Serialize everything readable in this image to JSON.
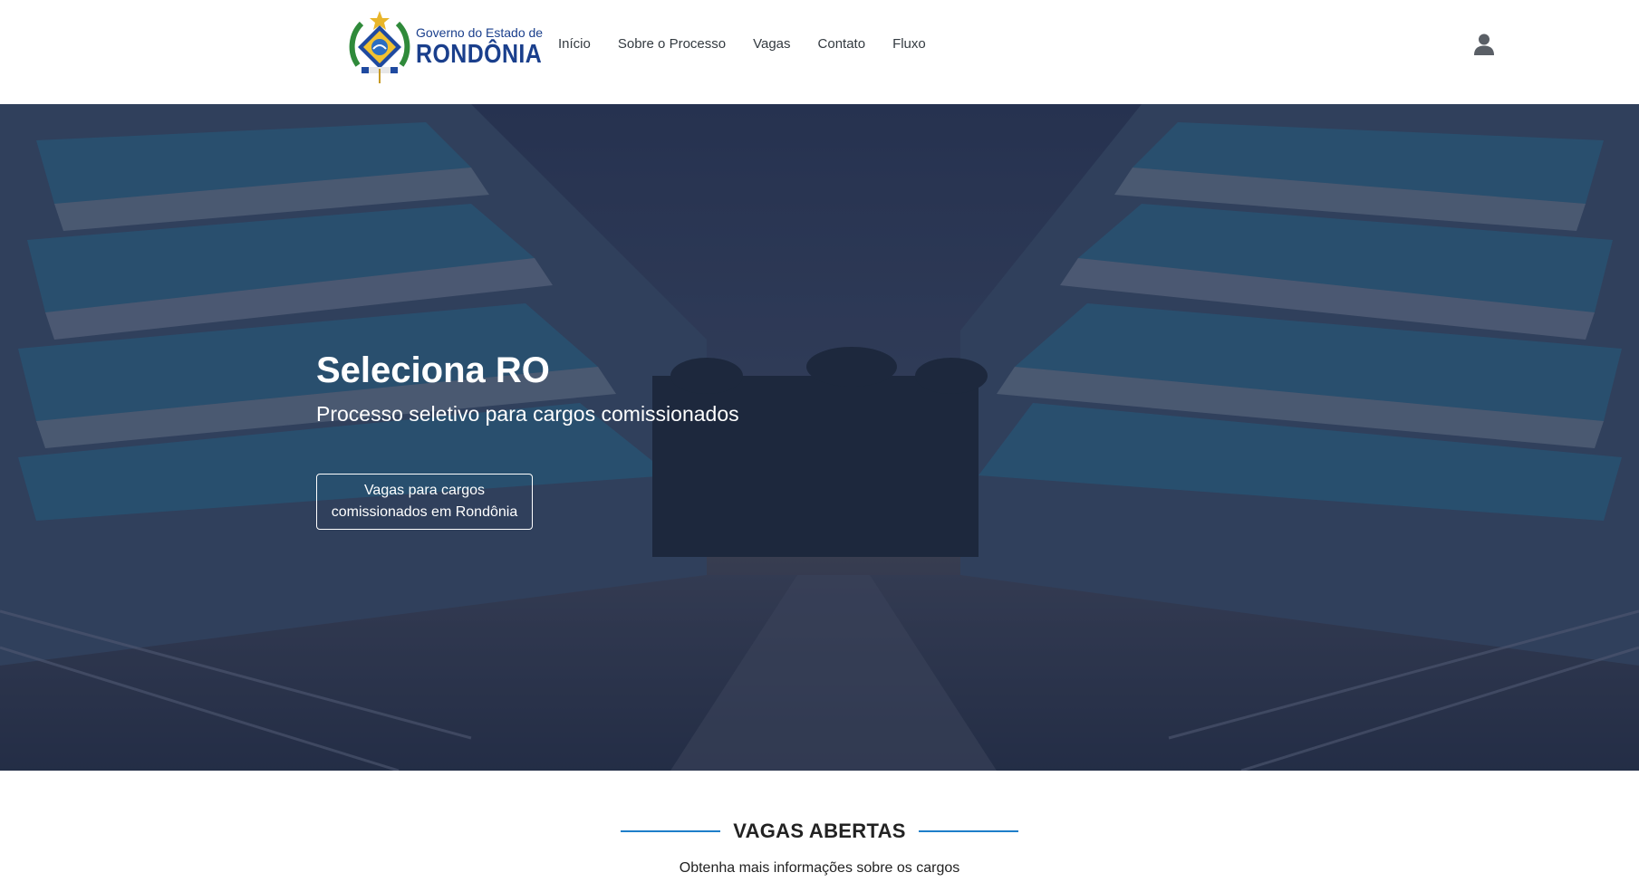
{
  "header": {
    "logo": {
      "small_text": "Governo do Estado de",
      "big_text": "RONDÔNIA"
    },
    "nav": [
      {
        "label": "Início"
      },
      {
        "label": "Sobre o Processo"
      },
      {
        "label": "Vagas"
      },
      {
        "label": "Contato"
      },
      {
        "label": "Fluxo"
      }
    ],
    "user_icon": "user-icon"
  },
  "hero": {
    "title": "Seleciona RO",
    "subtitle": "Processo seletivo para cargos comissionados",
    "button_label": "Vagas para cargos comissionados em Rondônia"
  },
  "section": {
    "heading": "VAGAS ABERTAS",
    "subtitle": "Obtenha mais informações sobre os cargos"
  },
  "colors": {
    "brand_blue": "#1a3f8c",
    "accent_line": "#1e7ec9",
    "hero_overlay": "#1f2d4a"
  }
}
